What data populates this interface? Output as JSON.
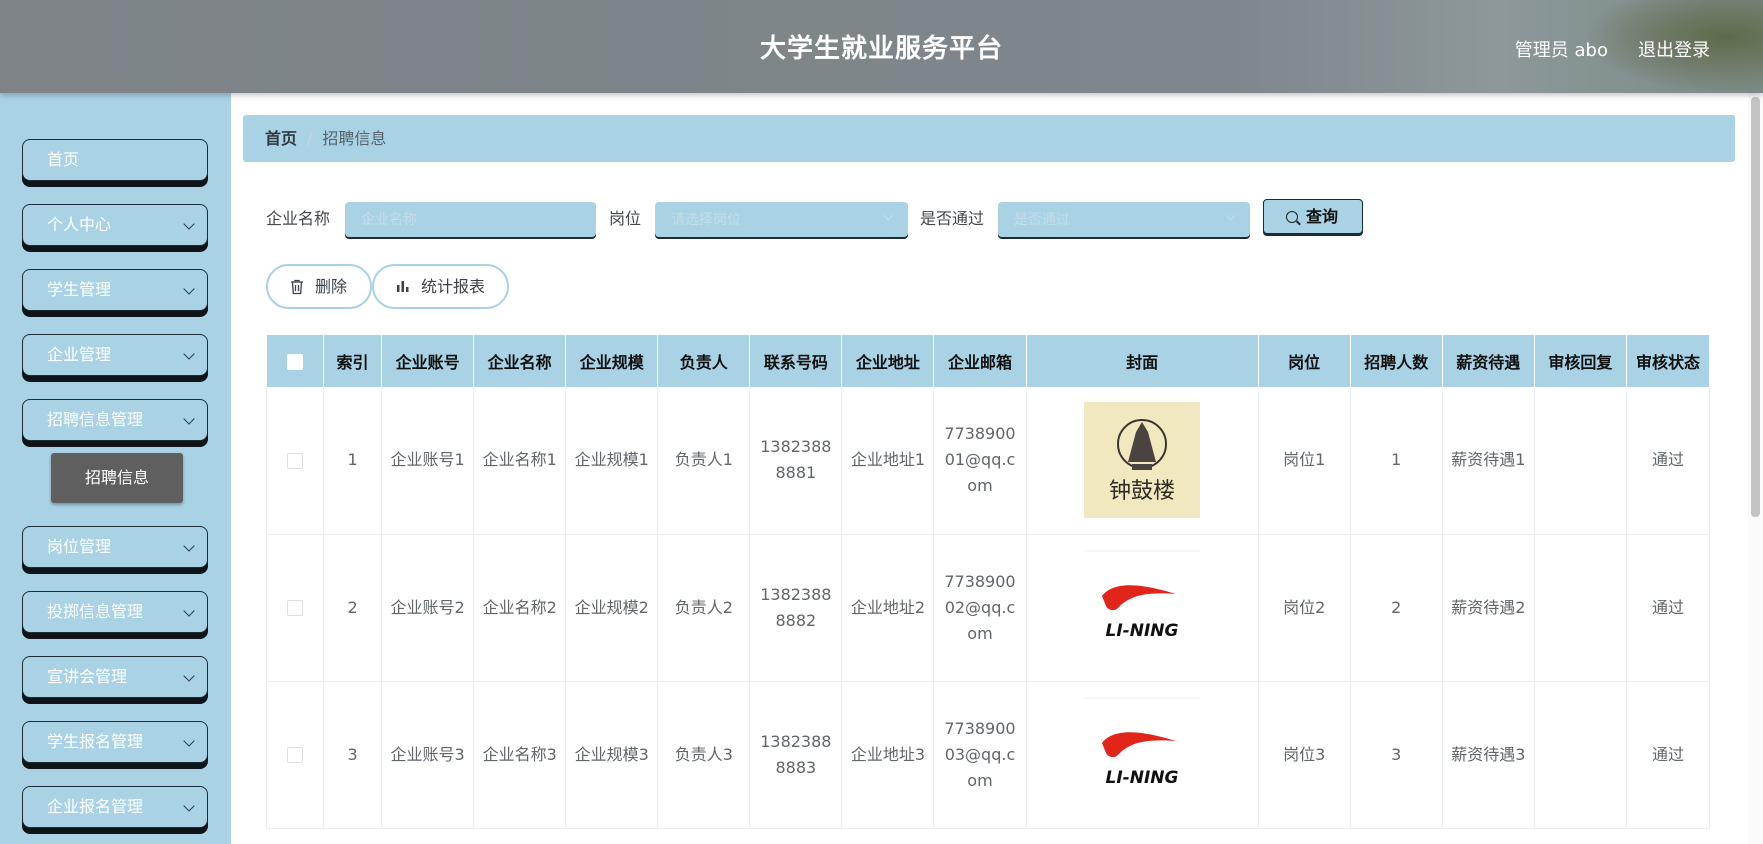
{
  "header": {
    "title": "大学生就业服务平台",
    "user": "管理员 abo",
    "logout": "退出登录"
  },
  "sidebar": {
    "items": [
      {
        "label": "首页",
        "has_arrow": false
      },
      {
        "label": "个人中心",
        "has_arrow": true
      },
      {
        "label": "学生管理",
        "has_arrow": true
      },
      {
        "label": "企业管理",
        "has_arrow": true
      },
      {
        "label": "招聘信息管理",
        "has_arrow": true
      },
      {
        "label": "岗位管理",
        "has_arrow": true
      },
      {
        "label": "投掷信息管理",
        "has_arrow": true
      },
      {
        "label": "宣讲会管理",
        "has_arrow": true
      },
      {
        "label": "学生报名管理",
        "has_arrow": true
      },
      {
        "label": "企业报名管理",
        "has_arrow": true
      }
    ],
    "active_sub": "招聘信息"
  },
  "breadcrumb": {
    "home": "首页",
    "separator": "/",
    "current": "招聘信息"
  },
  "search": {
    "company_label": "企业名称",
    "company_placeholder": "企业名称",
    "position_label": "岗位",
    "position_placeholder": "请选择岗位",
    "passed_label": "是否通过",
    "passed_placeholder": "是否通过",
    "query_button": "查询"
  },
  "actions": {
    "delete": "删除",
    "report": "统计报表"
  },
  "table": {
    "columns": [
      "",
      "索引",
      "企业账号",
      "企业名称",
      "企业规模",
      "负责人",
      "联系号码",
      "企业地址",
      "企业邮箱",
      "封面",
      "岗位",
      "招聘人数",
      "薪资待遇",
      "审核回复",
      "审核状态"
    ],
    "rows": [
      {
        "index": "1",
        "account": "企业账号1",
        "name": "企业名称1",
        "scale": "企业规模1",
        "manager": "负责人1",
        "phone": "13823888881",
        "address": "企业地址1",
        "email": "773890001@qq.com",
        "cover": "钟鼓楼",
        "position": "岗位1",
        "count": "1",
        "salary": "薪资待遇1",
        "reply": "",
        "status": "通过"
      },
      {
        "index": "2",
        "account": "企业账号2",
        "name": "企业名称2",
        "scale": "企业规模2",
        "manager": "负责人2",
        "phone": "13823888882",
        "address": "企业地址2",
        "email": "773890002@qq.com",
        "cover": "LI-NING",
        "position": "岗位2",
        "count": "2",
        "salary": "薪资待遇2",
        "reply": "",
        "status": "通过"
      },
      {
        "index": "3",
        "account": "企业账号3",
        "name": "企业名称3",
        "scale": "企业规模3",
        "manager": "负责人3",
        "phone": "13823888883",
        "address": "企业地址3",
        "email": "773890003@qq.com",
        "cover": "LI-NING",
        "position": "岗位3",
        "count": "3",
        "salary": "薪资待遇3",
        "reply": "",
        "status": "通过"
      }
    ]
  },
  "colors": {
    "accent": "#a9d3e5",
    "header": "#7f878c",
    "active_sub": "#5f5f5f",
    "lining_red": "#e1251b"
  }
}
